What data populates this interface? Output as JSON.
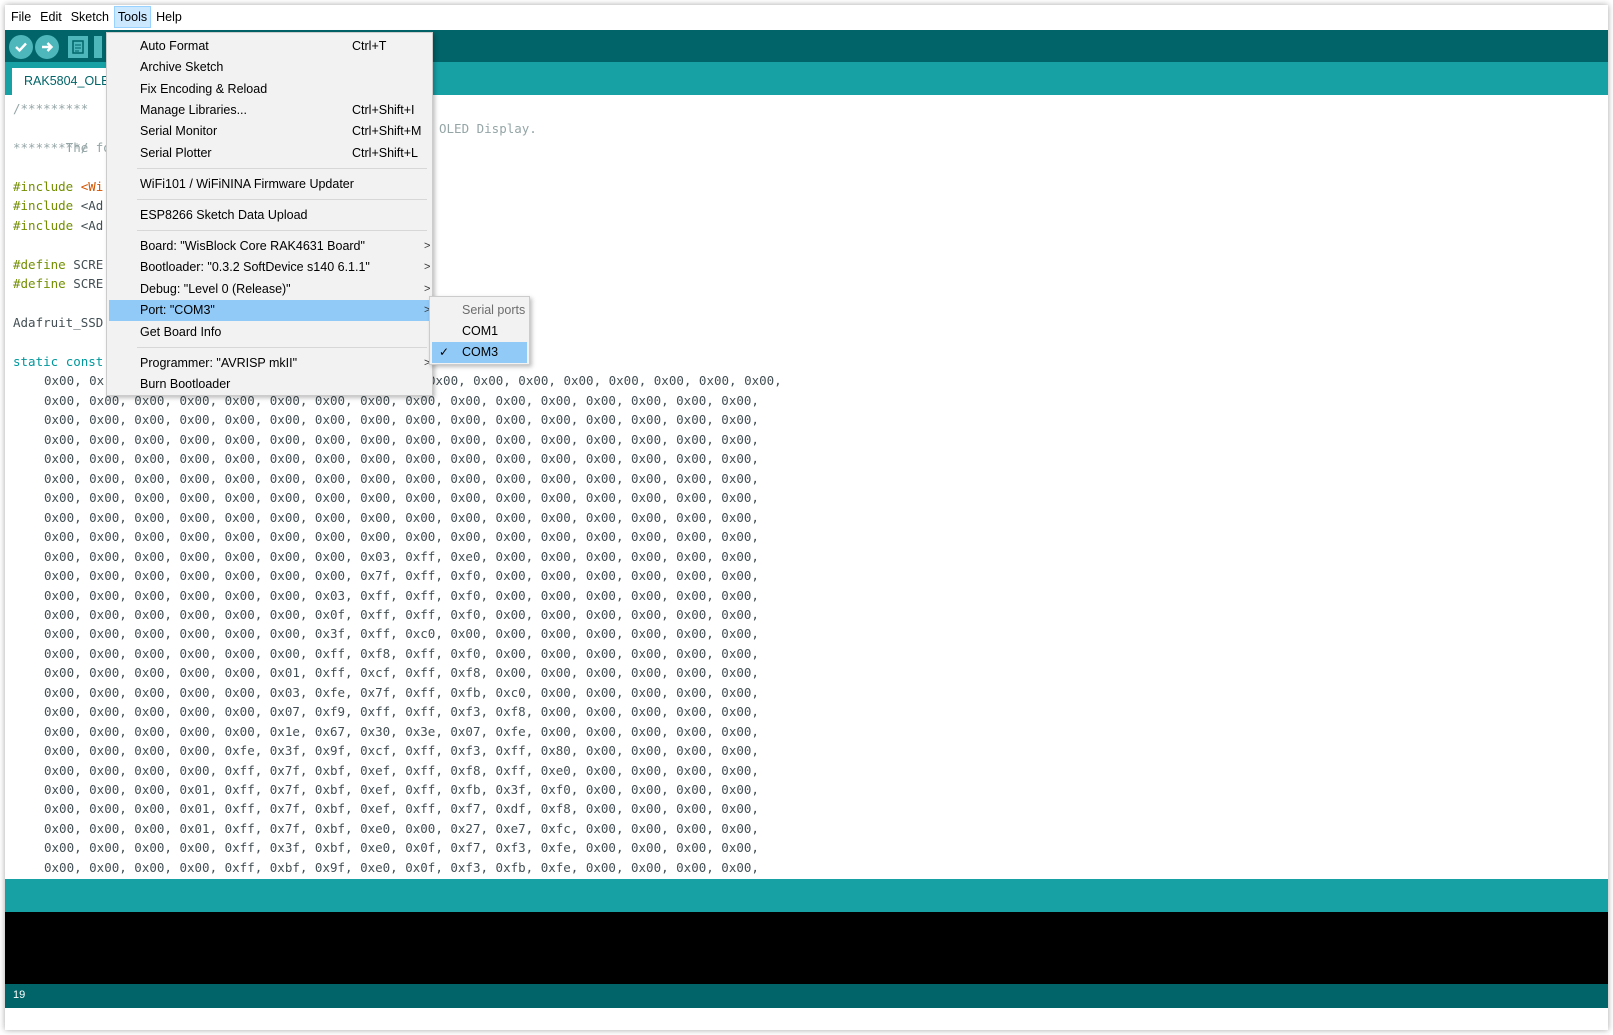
{
  "menubar": {
    "items": [
      {
        "label": "File"
      },
      {
        "label": "Edit"
      },
      {
        "label": "Sketch"
      },
      {
        "label": "Tools"
      },
      {
        "label": "Help"
      }
    ]
  },
  "tab": {
    "label": "RAK5804_OLED"
  },
  "tools_menu": {
    "items": [
      {
        "label": "Auto Format",
        "shortcut": "Ctrl+T"
      },
      {
        "label": "Archive Sketch",
        "shortcut": ""
      },
      {
        "label": "Fix Encoding & Reload",
        "shortcut": ""
      },
      {
        "label": "Manage Libraries...",
        "shortcut": "Ctrl+Shift+I"
      },
      {
        "label": "Serial Monitor",
        "shortcut": "Ctrl+Shift+M"
      },
      {
        "label": "Serial Plotter",
        "shortcut": "Ctrl+Shift+L"
      },
      {
        "label": "WiFi101 / WiFiNINA Firmware Updater",
        "shortcut": ""
      },
      {
        "label": "ESP8266 Sketch Data Upload",
        "shortcut": ""
      },
      {
        "label": "Board: \"WisBlock Core RAK4631 Board\"",
        "shortcut": ""
      },
      {
        "label": "Bootloader: \"0.3.2 SoftDevice s140 6.1.1\"",
        "shortcut": ""
      },
      {
        "label": "Debug: \"Level 0 (Release)\"",
        "shortcut": ""
      },
      {
        "label": "Port: \"COM3\"",
        "shortcut": ""
      },
      {
        "label": "Get Board Info",
        "shortcut": ""
      },
      {
        "label": "Programmer: \"AVRISP mkII\"",
        "shortcut": ""
      },
      {
        "label": "Burn Bootloader",
        "shortcut": ""
      }
    ],
    "submenu_arrow": ">",
    "port_submenu": {
      "header": "Serial ports",
      "items": [
        {
          "label": "COM1"
        },
        {
          "label": "COM3"
        }
      ],
      "check_icon": "✓"
    }
  },
  "editor": {
    "comment_start": "/*********",
    "comment_text_left": " The follow",
    "comment_text_right": "OLED Display.",
    "comment_end": "*********/",
    "includes": [
      {
        "kw": "#include",
        "rest": "<Wi"
      },
      {
        "kw": "#include",
        "rest": "<Ad"
      },
      {
        "kw": "#include",
        "rest": "<Ad"
      }
    ],
    "defines": [
      {
        "kw": "#define",
        "rest": "SCRE"
      },
      {
        "kw": "#define",
        "rest": "SCRE"
      }
    ],
    "adafruit": "Adafruit_SSD",
    "static_kw": "static",
    "const_kw": "const",
    "first_hex_left": "0x00, 0x",
    "first_hex_right": "0x00, 0x00, 0x00, 0x00, 0x00, 0x00, 0x00, 0x00,",
    "hex_rows": [
      "0x00, 0x00, 0x00, 0x00, 0x00, 0x00, 0x00, 0x00, 0x00, 0x00, 0x00, 0x00, 0x00, 0x00, 0x00, 0x00,",
      "0x00, 0x00, 0x00, 0x00, 0x00, 0x00, 0x00, 0x00, 0x00, 0x00, 0x00, 0x00, 0x00, 0x00, 0x00, 0x00,",
      "0x00, 0x00, 0x00, 0x00, 0x00, 0x00, 0x00, 0x00, 0x00, 0x00, 0x00, 0x00, 0x00, 0x00, 0x00, 0x00,",
      "0x00, 0x00, 0x00, 0x00, 0x00, 0x00, 0x00, 0x00, 0x00, 0x00, 0x00, 0x00, 0x00, 0x00, 0x00, 0x00,",
      "0x00, 0x00, 0x00, 0x00, 0x00, 0x00, 0x00, 0x00, 0x00, 0x00, 0x00, 0x00, 0x00, 0x00, 0x00, 0x00,",
      "0x00, 0x00, 0x00, 0x00, 0x00, 0x00, 0x00, 0x00, 0x00, 0x00, 0x00, 0x00, 0x00, 0x00, 0x00, 0x00,",
      "0x00, 0x00, 0x00, 0x00, 0x00, 0x00, 0x00, 0x00, 0x00, 0x00, 0x00, 0x00, 0x00, 0x00, 0x00, 0x00,",
      "0x00, 0x00, 0x00, 0x00, 0x00, 0x00, 0x00, 0x00, 0x00, 0x00, 0x00, 0x00, 0x00, 0x00, 0x00, 0x00,",
      "0x00, 0x00, 0x00, 0x00, 0x00, 0x00, 0x00, 0x03, 0xff, 0xe0, 0x00, 0x00, 0x00, 0x00, 0x00, 0x00,",
      "0x00, 0x00, 0x00, 0x00, 0x00, 0x00, 0x00, 0x7f, 0xff, 0xf0, 0x00, 0x00, 0x00, 0x00, 0x00, 0x00,",
      "0x00, 0x00, 0x00, 0x00, 0x00, 0x00, 0x03, 0xff, 0xff, 0xf0, 0x00, 0x00, 0x00, 0x00, 0x00, 0x00,",
      "0x00, 0x00, 0x00, 0x00, 0x00, 0x00, 0x0f, 0xff, 0xff, 0xf0, 0x00, 0x00, 0x00, 0x00, 0x00, 0x00,",
      "0x00, 0x00, 0x00, 0x00, 0x00, 0x00, 0x3f, 0xff, 0xc0, 0x00, 0x00, 0x00, 0x00, 0x00, 0x00, 0x00,",
      "0x00, 0x00, 0x00, 0x00, 0x00, 0x00, 0xff, 0xf8, 0xff, 0xf0, 0x00, 0x00, 0x00, 0x00, 0x00, 0x00,",
      "0x00, 0x00, 0x00, 0x00, 0x00, 0x01, 0xff, 0xcf, 0xff, 0xf8, 0x00, 0x00, 0x00, 0x00, 0x00, 0x00,",
      "0x00, 0x00, 0x00, 0x00, 0x00, 0x03, 0xfe, 0x7f, 0xff, 0xfb, 0xc0, 0x00, 0x00, 0x00, 0x00, 0x00,",
      "0x00, 0x00, 0x00, 0x00, 0x00, 0x07, 0xf9, 0xff, 0xff, 0xf3, 0xf8, 0x00, 0x00, 0x00, 0x00, 0x00,",
      "0x00, 0x00, 0x00, 0x00, 0x00, 0x1e, 0x67, 0x30, 0x3e, 0x07, 0xfe, 0x00, 0x00, 0x00, 0x00, 0x00,",
      "0x00, 0x00, 0x00, 0x00, 0xfe, 0x3f, 0x9f, 0xcf, 0xff, 0xf3, 0xff, 0x80, 0x00, 0x00, 0x00, 0x00,",
      "0x00, 0x00, 0x00, 0x00, 0xff, 0x7f, 0xbf, 0xef, 0xff, 0xf8, 0xff, 0xe0, 0x00, 0x00, 0x00, 0x00,",
      "0x00, 0x00, 0x00, 0x01, 0xff, 0x7f, 0xbf, 0xef, 0xff, 0xfb, 0x3f, 0xf0, 0x00, 0x00, 0x00, 0x00,",
      "0x00, 0x00, 0x00, 0x01, 0xff, 0x7f, 0xbf, 0xef, 0xff, 0xf7, 0xdf, 0xf8, 0x00, 0x00, 0x00, 0x00,",
      "0x00, 0x00, 0x00, 0x01, 0xff, 0x7f, 0xbf, 0xe0, 0x00, 0x27, 0xe7, 0xfc, 0x00, 0x00, 0x00, 0x00,",
      "0x00, 0x00, 0x00, 0x00, 0xff, 0x3f, 0xbf, 0xe0, 0x0f, 0xf7, 0xf3, 0xfe, 0x00, 0x00, 0x00, 0x00,",
      "0x00, 0x00, 0x00, 0x00, 0xff, 0xbf, 0x9f, 0xe0, 0x0f, 0xf3, 0xfb, 0xfe, 0x00, 0x00, 0x00, 0x00,"
    ]
  },
  "footer": {
    "line_number": "19"
  },
  "colors": {
    "toolbar": "#006468",
    "tabbar": "#17a1a5",
    "menu_highlight": "#91c9f7",
    "console": "#000000"
  },
  "toolbar_icons": [
    "verify-icon",
    "upload-icon",
    "new-sketch-icon",
    "open-icon"
  ]
}
